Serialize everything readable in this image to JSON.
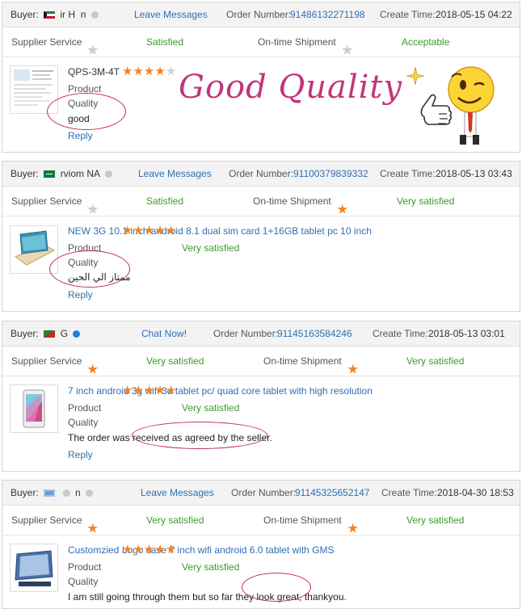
{
  "orders": [
    {
      "buyer_label": "Buyer:",
      "buyer_name_a": "ir H",
      "buyer_name_b": "n",
      "contact": "Leave Messages",
      "order_label": "Order Number:",
      "order_number": "91486132271198",
      "time_label": "Create Time:",
      "create_time": "2018-05-15 04:22",
      "supplier_label": "Supplier Service",
      "supplier_status": "Satisfied",
      "shipment_label": "On-time Shipment",
      "shipment_status": "Acceptable",
      "product_title": "QPS-3M-4T",
      "product_label": "Product",
      "product_status": "",
      "quality_label": "Quality",
      "review": "good",
      "reply": "Reply"
    },
    {
      "buyer_label": "Buyer:",
      "buyer_name_a": "rviom NA",
      "contact": "Leave Messages",
      "order_label": "Order Number:",
      "order_number": "91100379839332",
      "time_label": "Create Time:",
      "create_time": "2018-05-13 03:43",
      "supplier_label": "Supplier Service",
      "supplier_status": "Satisfied",
      "shipment_label": "On-time Shipment",
      "shipment_status": "Very satisfied",
      "product_title": "NEW 3G 10.1 inch android 8.1 dual sim card 1+16GB tablet pc 10 inch",
      "product_label": "Product",
      "product_status": "Very satisfied",
      "quality_label": "Quality",
      "review": "ممتاز الي الحين",
      "reply": "Reply"
    },
    {
      "buyer_label": "Buyer:",
      "buyer_name_a": "G",
      "contact": "Chat Now!",
      "order_label": "Order Number:",
      "order_number": "91145163584246",
      "time_label": "Create Time:",
      "create_time": "2018-05-13 03:01",
      "supplier_label": "Supplier Service",
      "supplier_status": "Very satisfied",
      "shipment_label": "On-time Shipment",
      "shipment_status": "Very satisfied",
      "product_title": "7 inch android 3g wifi 3d tablet pc/ quad core tablet with high resolution",
      "product_label": "Product",
      "product_status": "Very satisfied",
      "quality_label": "Quality",
      "review": "The order was received as agreed by the seller.",
      "reply": "Reply"
    },
    {
      "buyer_label": "Buyer:",
      "buyer_name_a": "n",
      "contact": "Leave Messages",
      "order_label": "Order Number:",
      "order_number": "91145325652147",
      "time_label": "Create Time:",
      "create_time": "2018-04-30 18:53",
      "supplier_label": "Supplier Service",
      "supplier_status": "Very satisfied",
      "shipment_label": "On-time Shipment",
      "shipment_status": "Very satisfied",
      "product_title": "Customzied Logo case 7 inch wifi android 6.0 tablet with GMS",
      "product_label": "Product",
      "product_status": "Very satisfied",
      "quality_label": "Quality",
      "review": "I am still going through them but so far they look great, thankyou.",
      "reply": ""
    }
  ],
  "ratings": {
    "o1_supplier": 4,
    "o1_shipment": 4,
    "o1_product": 4,
    "o2_supplier": 4,
    "o2_shipment": 5,
    "o2_product": 5,
    "o3_supplier": 5,
    "o3_shipment": 5,
    "o3_product": 5,
    "o4_supplier": 5,
    "o4_shipment": 5,
    "o4_product": 5
  },
  "overlay": {
    "text": "Good Quality",
    "color": "#c2357a"
  },
  "colors": {
    "star_on": "#f58220",
    "star_off": "#cfcfcf",
    "link": "#2f6fb3",
    "satisfied": "#3a9b2a",
    "annotation": "#c0304a"
  }
}
